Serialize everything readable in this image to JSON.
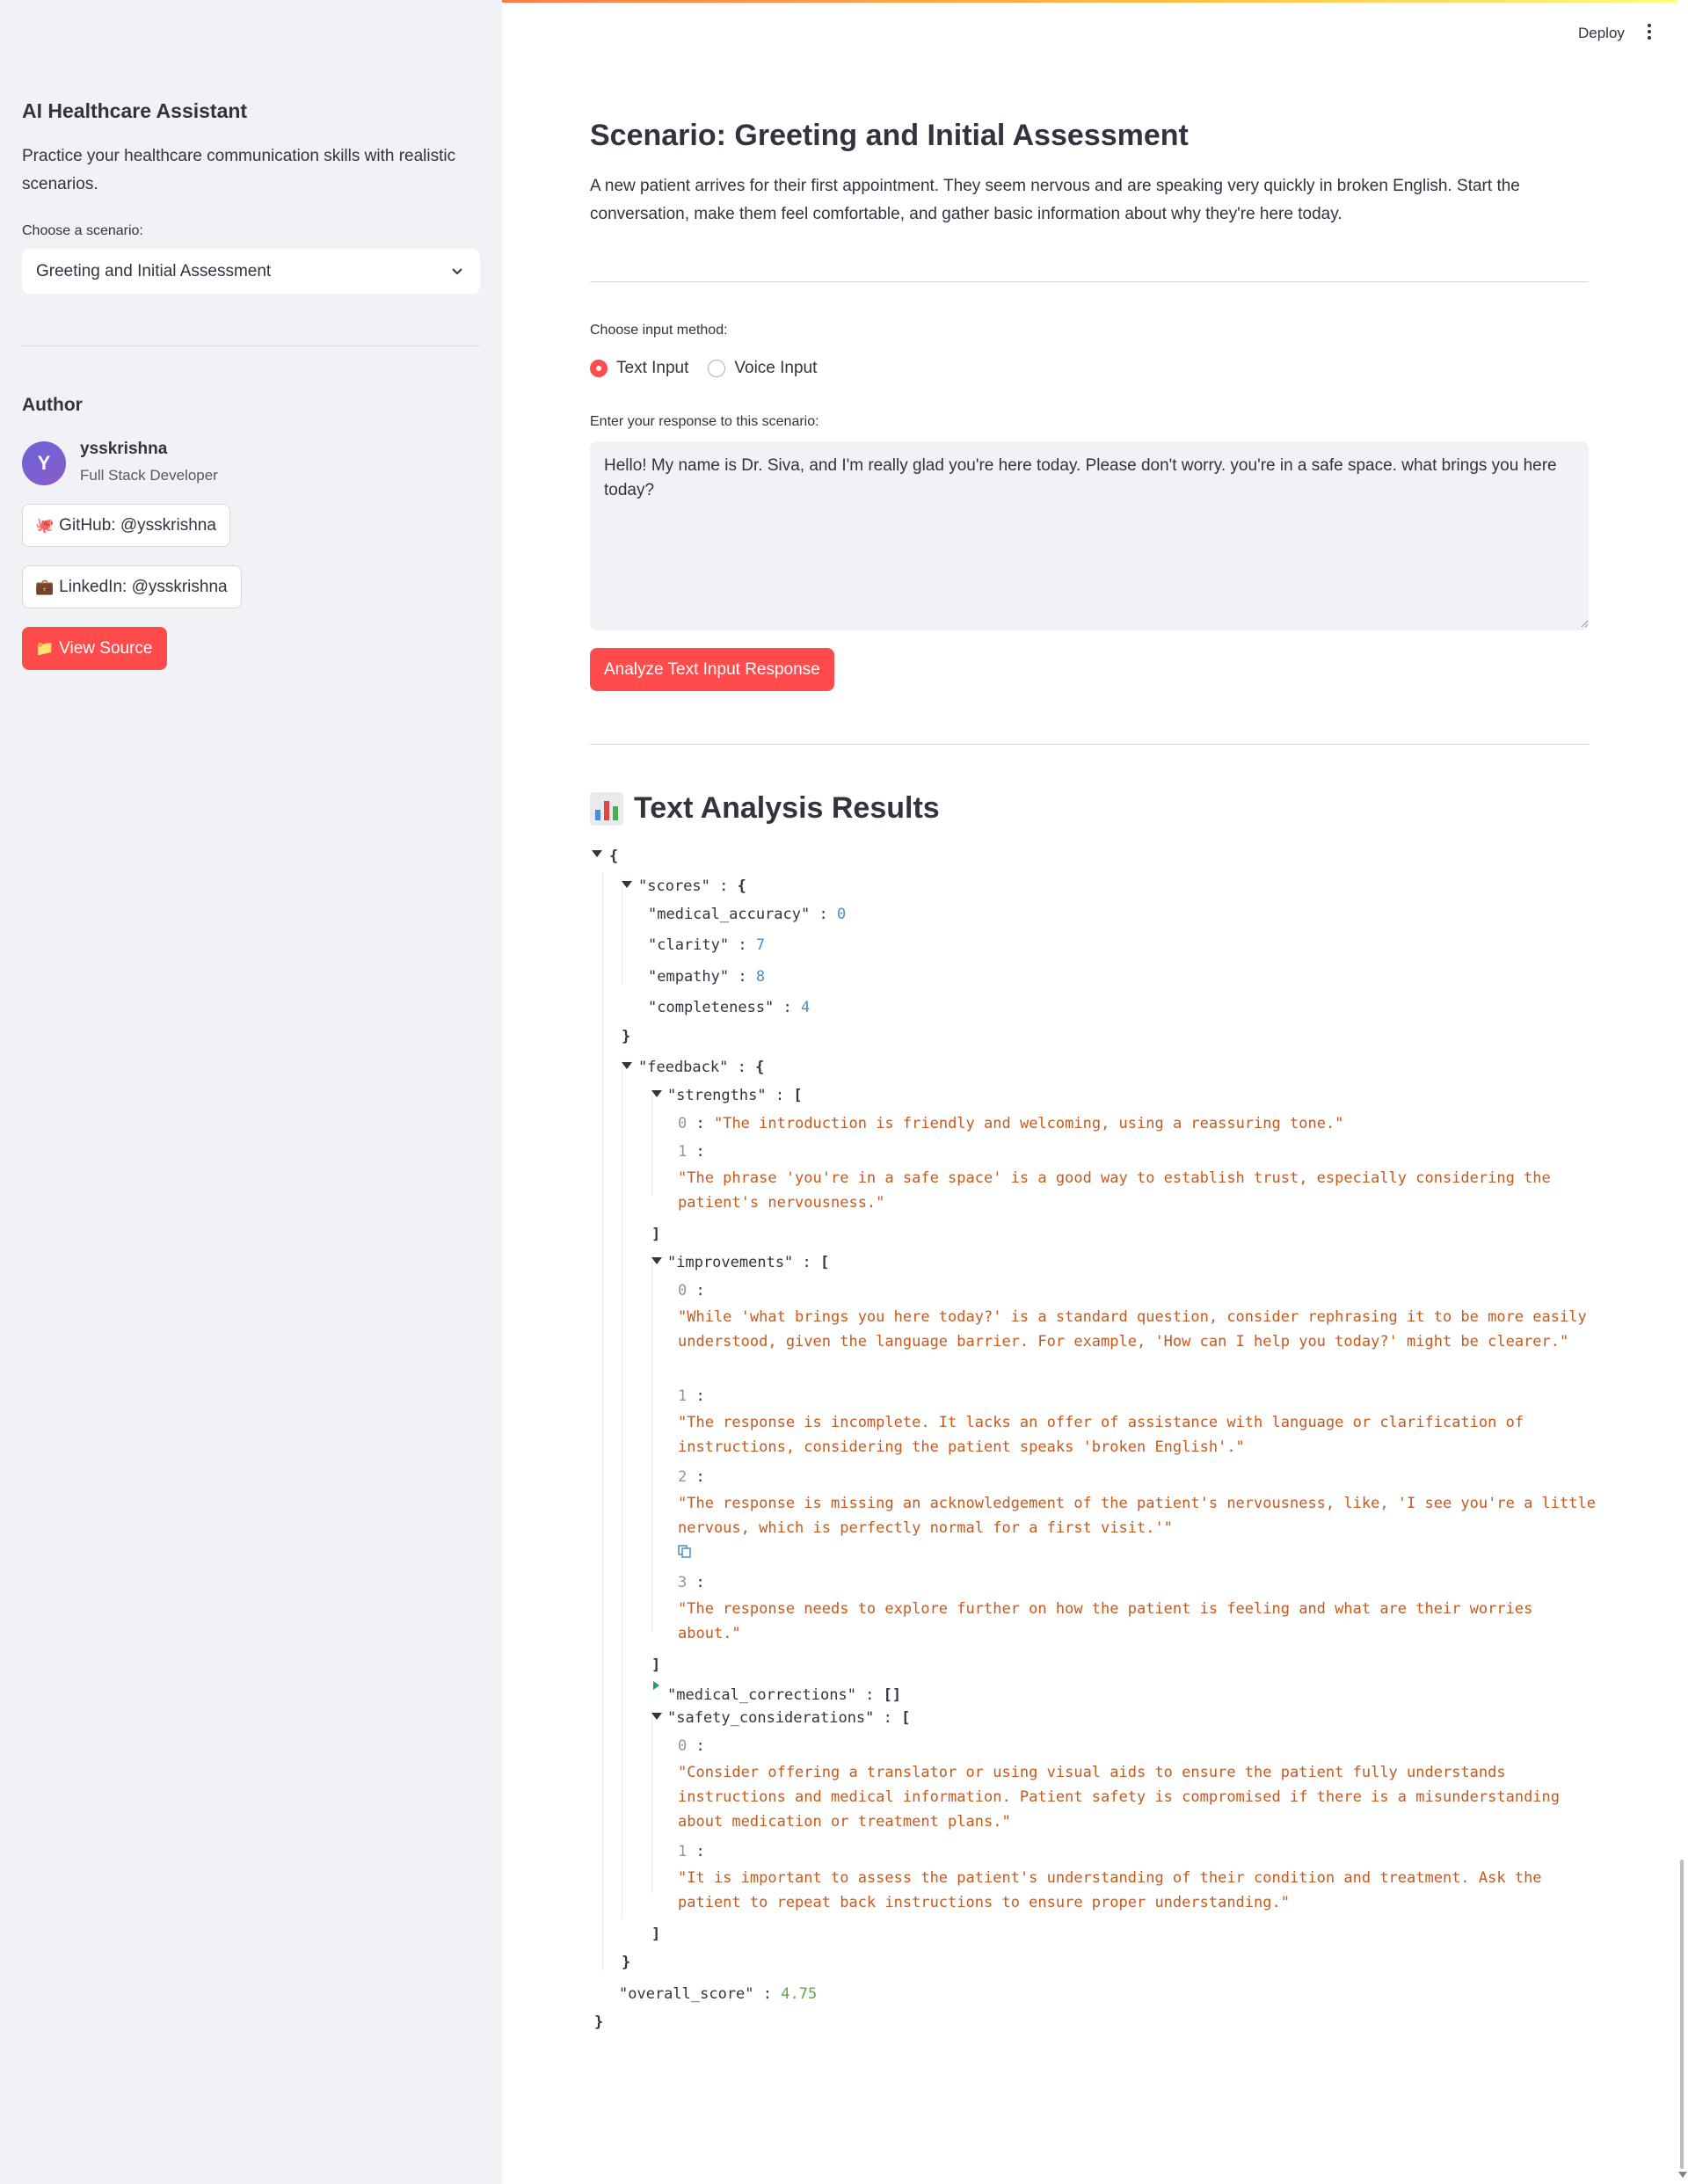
{
  "sidebar": {
    "title": "AI Healthcare Assistant",
    "description": "Practice your healthcare communication skills with realistic scenarios.",
    "scenario_label": "Choose a scenario:",
    "scenario_selected": "Greeting and Initial Assessment",
    "author_heading": "Author",
    "author": {
      "avatar_letter": "Y",
      "name": "ysskrishna",
      "role": "Full Stack Developer"
    },
    "buttons": {
      "github": "GitHub: @ysskrishna",
      "linkedin": "LinkedIn: @ysskrishna",
      "source": "View Source"
    }
  },
  "header": {
    "deploy": "Deploy"
  },
  "main": {
    "scenario_title": "Scenario: Greeting and Initial Assessment",
    "scenario_desc": "A new patient arrives for their first appointment. They seem nervous and are speaking very quickly in broken English. Start the conversation, make them feel comfortable, and gather basic information about why they're here today.",
    "input_method_label": "Choose input method:",
    "input_options": [
      "Text Input",
      "Voice Input"
    ],
    "input_selected": "Text Input",
    "response_label": "Enter your response to this scenario:",
    "response_text": "Hello! My name is Dr. Siva, and I'm really glad you're here today. Please don't worry. you're in a safe space. what brings you here today?",
    "analyze_button": "Analyze Text Input Response",
    "results_title": "Text Analysis Results"
  },
  "analysis": {
    "scores": {
      "medical_accuracy": "0",
      "clarity": "7",
      "empathy": "8",
      "completeness": "4"
    },
    "strengths": [
      "\"The introduction is friendly and welcoming, using a reassuring tone.\"",
      "\"The phrase 'you're in a safe space' is a good way to establish trust, especially considering the patient's nervousness.\""
    ],
    "improvements": [
      "\"While 'what brings you here today?' is a standard question, consider rephrasing it to be more easily understood, given the language barrier. For example, 'How can I help you today?' might be clearer.\"",
      "\"The response is incomplete. It lacks an offer of assistance with language or clarification of instructions, considering the patient speaks 'broken English'.\"",
      "\"The response is missing an acknowledgement of the patient's nervousness, like, 'I see you're a little nervous, which is perfectly normal for a first visit.'\"",
      "\"The response needs to explore further on how the patient is feeling and what are their worries about.\""
    ],
    "safety_considerations": [
      "\"Consider offering a translator or using visual aids to ensure the patient fully understands instructions and medical information. Patient safety is compromised if there is a misunderstanding about medication or treatment plans.\"",
      "\"It is important to assess the patient's understanding of their condition and treatment. Ask the patient to repeat back instructions to ensure proper understanding.\""
    ],
    "overall_score": "4.75"
  },
  "json_keys": {
    "scores": "\"scores\"",
    "medical_accuracy": "\"medical_accuracy\"",
    "clarity": "\"clarity\"",
    "empathy": "\"empathy\"",
    "completeness": "\"completeness\"",
    "feedback": "\"feedback\"",
    "strengths": "\"strengths\"",
    "improvements": "\"improvements\"",
    "medical_corrections": "\"medical_corrections\"",
    "safety_considerations": "\"safety_considerations\"",
    "overall_score": "\"overall_score\""
  },
  "colors": {
    "primary": "#ff4b4b",
    "sidebar_bg": "#f0f2f6",
    "json_string": "#c55a1f",
    "json_number": "#4d8fbd",
    "json_float": "#62a845"
  }
}
